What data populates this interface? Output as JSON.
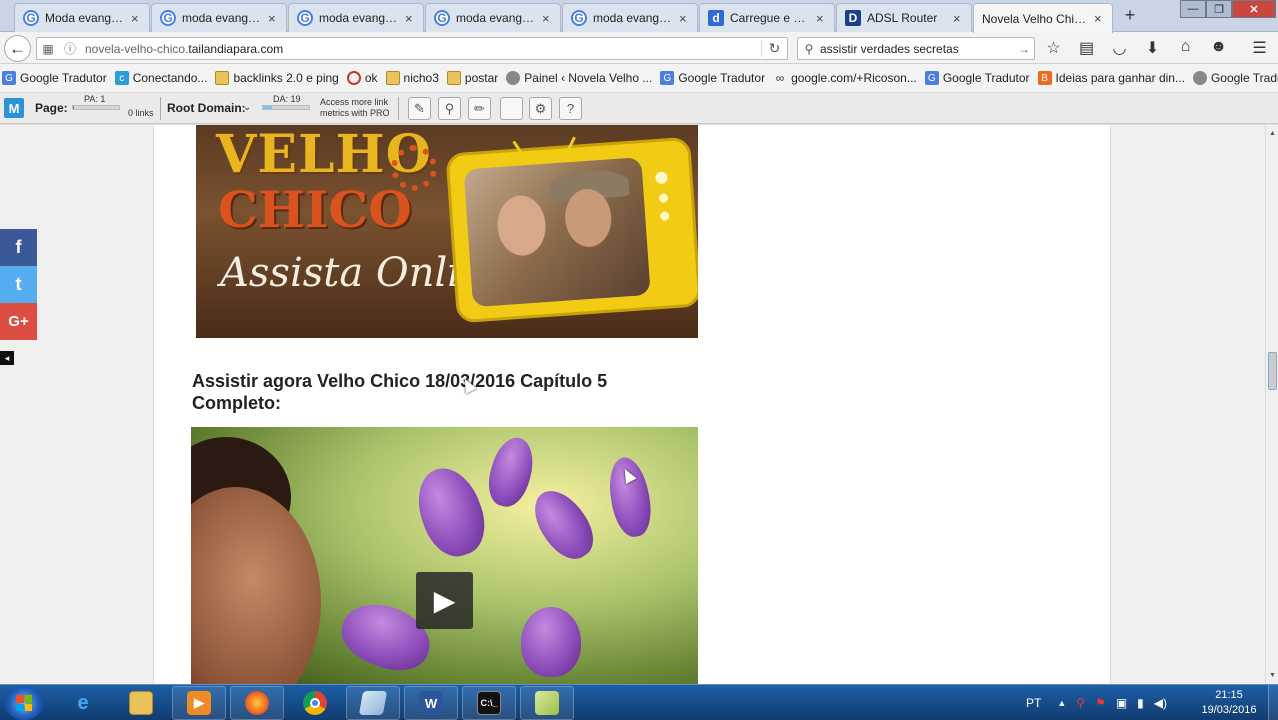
{
  "tabs": [
    {
      "label": "Moda evangéli...",
      "icon": "google-icon"
    },
    {
      "label": "moda evangéli...",
      "icon": "google-icon"
    },
    {
      "label": "moda evangéli...",
      "icon": "google-icon"
    },
    {
      "label": "moda evangéli...",
      "icon": "google-icon"
    },
    {
      "label": "moda evangéli...",
      "icon": "google-icon"
    },
    {
      "label": "Carregue e co...",
      "icon": "dailymotion-icon"
    },
    {
      "label": "ADSL Router",
      "icon": "router-d-icon"
    },
    {
      "label": "Novela Velho Chic...",
      "icon": "page-icon",
      "active": true
    }
  ],
  "tab_close_glyph": "×",
  "new_tab_glyph": "+",
  "window_controls": {
    "minimize": "—",
    "maximize": "❐",
    "close": "✕"
  },
  "nav": {
    "url_plain": "novela-velho-chico.",
    "url_domain": "tailandiapara.com",
    "search_query": "assistir verdades secretas"
  },
  "bookmarks": [
    {
      "label": "Google Tradutor",
      "icon": "translate-icon"
    },
    {
      "label": "Conectando...",
      "icon": "conectando-icon"
    },
    {
      "label": "backlinks 2.0 e ping",
      "icon": "folder-icon"
    },
    {
      "label": "ok",
      "icon": "opera-icon"
    },
    {
      "label": "nicho3",
      "icon": "folder-icon"
    },
    {
      "label": "postar",
      "icon": "folder-icon"
    },
    {
      "label": "Painel ‹ Novela Velho ...",
      "icon": "globe-icon"
    },
    {
      "label": "Google Tradutor",
      "icon": "translate-icon"
    },
    {
      "label": "google.com/+Ricoson...",
      "icon": "link-icon"
    },
    {
      "label": "Google Tradutor",
      "icon": "translate-icon"
    },
    {
      "label": "Ideias para ganhar din...",
      "icon": "blogger-icon"
    },
    {
      "label": "Google Tradutor",
      "icon": "globe-icon"
    }
  ],
  "bookmarks_more": "»",
  "mozbar": {
    "logo": "M",
    "page_label": "Page:",
    "pa": "PA: 1",
    "pa_fraction": 0.01,
    "links": "0 links",
    "root_domain_label": "Root Domain:",
    "da": "DA: 19",
    "da_fraction": 0.19,
    "pro_line1": "Access more link",
    "pro_line2": "metrics with PRO"
  },
  "banner": {
    "word1": "VELHO",
    "word2": "CHICO",
    "tagline": "Assista Online"
  },
  "post_title": "Assistir agora Velho Chico 18/03/2016 Capítulo 5 Completo:",
  "share": {
    "facebook": "f",
    "twitter": "t",
    "googleplus": "G+"
  },
  "taskbar": {
    "language": "PT",
    "time": "21:15",
    "date": "19/03/2016"
  },
  "colors": {
    "facebook": "#3b5998",
    "twitter": "#55acee",
    "googleplus": "#dc4e41",
    "taskbar": "#174f8f"
  }
}
